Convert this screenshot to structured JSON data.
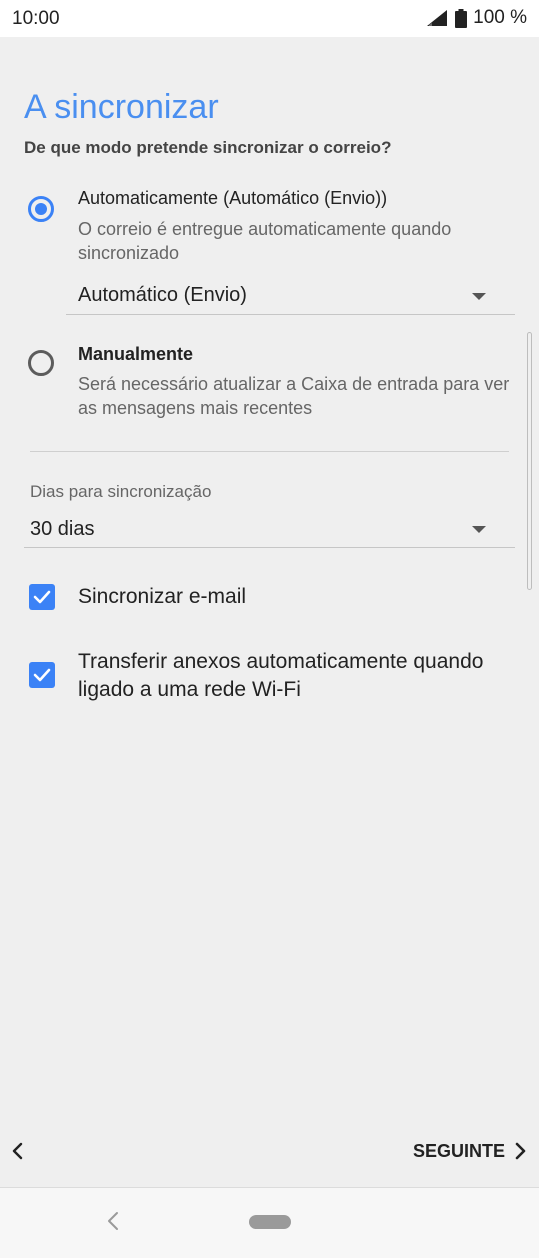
{
  "status_bar": {
    "time": "10:00",
    "battery": "100 %",
    "signal_icon": "signal-icon",
    "battery_icon": "battery-icon"
  },
  "page": {
    "title": "A sincronizar",
    "subtitle": "De que modo pretende sincronizar o correio?"
  },
  "sync_options": [
    {
      "label": "Automaticamente (Automático (Envio))",
      "description": "O correio é entregue automaticamente quando sincronizado",
      "selected": true
    },
    {
      "label": "Manualmente",
      "description": "Será necessário atualizar a Caixa de entrada para ver as mensagens mais recentes",
      "selected": false
    }
  ],
  "auto_mode_dropdown": {
    "value": "Automático (Envio)"
  },
  "sync_days": {
    "label": "Dias para sincronização",
    "value": "30 dias"
  },
  "checkboxes": [
    {
      "label": "Sincronizar e-mail",
      "checked": true
    },
    {
      "label": "Transferir anexos automaticamente quando ligado a uma rede Wi-Fi",
      "checked": true
    }
  ],
  "footer": {
    "next_label": "SEGUINTE"
  },
  "colors": {
    "accent": "#3b82f6",
    "title": "#4a8ff0",
    "background": "#efefef"
  }
}
